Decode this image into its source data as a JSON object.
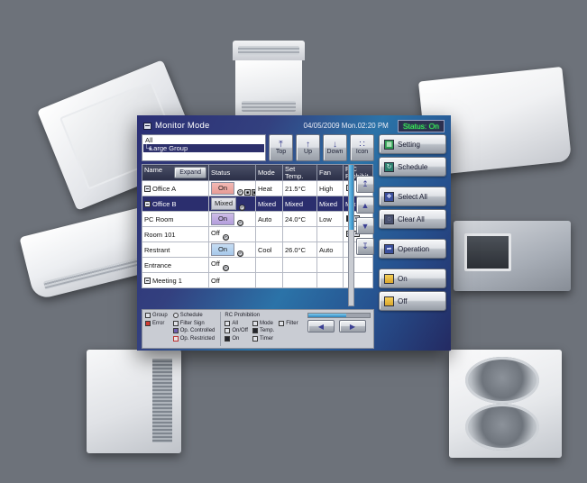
{
  "window": {
    "icon": "window-minimize-icon",
    "title": "Monitor Mode",
    "datetime": "04/05/2009 Mon.02:20 PM",
    "status_badge": "Status:  On",
    "status_color": "#39ff5a"
  },
  "tree": {
    "root_label": "All",
    "selected_label": "Large Group"
  },
  "nav_buttons": [
    {
      "label": "Top",
      "icon": "arrow-top-icon",
      "glyph": "⤒"
    },
    {
      "label": "Up",
      "icon": "arrow-up-icon",
      "glyph": "↑"
    },
    {
      "label": "Down",
      "icon": "arrow-down-icon",
      "glyph": "↓"
    },
    {
      "label": "Icon",
      "icon": "grid-view-icon",
      "glyph": "∷"
    }
  ],
  "table": {
    "expand_button": "Expand",
    "columns": [
      {
        "key": "name",
        "label": "Name"
      },
      {
        "key": "status",
        "label": "Status"
      },
      {
        "key": "mode",
        "label": "Mode"
      },
      {
        "key": "temp",
        "label": "Set\nTemp."
      },
      {
        "key": "fan",
        "label": "Fan"
      },
      {
        "key": "rc",
        "label": "R/C\nProhibit"
      }
    ],
    "column_labels": {
      "name": "Name",
      "status": "Status",
      "mode": "Mode",
      "temp_line1": "Set",
      "temp_line2": "Temp.",
      "fan": "Fan",
      "rc_line1": "R/C",
      "rc_line2": "Prohibit"
    },
    "rows": [
      {
        "name": "Office A",
        "group_icon": true,
        "selected": false,
        "status": "On",
        "status_style": "on-pink",
        "status_icons": [
          "schedule-icon",
          "op-controlled-icon",
          "filter-sign-icon",
          "op-restricted-icon"
        ],
        "mode": "Heat",
        "temp": "21.5°C",
        "fan": "High",
        "rc": "",
        "rc_icons": [
          "rc-all-icon"
        ]
      },
      {
        "name": "Office B",
        "group_icon": true,
        "selected": true,
        "status": "Mixed",
        "status_style": "mixed",
        "status_icons": [
          "schedule-icon"
        ],
        "mode": "Mixed",
        "temp": "Mixed",
        "fan": "Mixed",
        "rc": "Mixed",
        "rc_icons": []
      },
      {
        "name": "PC Room",
        "group_icon": false,
        "selected": false,
        "status": "On",
        "status_style": "on-purple",
        "status_icons": [
          "schedule-icon"
        ],
        "mode": "Auto",
        "temp": "24.0°C",
        "fan": "Low",
        "rc": "",
        "rc_icons": [
          "rc-on-icon",
          "rc-timer-icon"
        ]
      },
      {
        "name": "Room 101",
        "group_icon": false,
        "selected": false,
        "status": "Off",
        "status_style": "plain",
        "status_icons": [
          "schedule-icon"
        ],
        "mode": "",
        "temp": "",
        "fan": "",
        "rc": "",
        "rc_icons": [
          "rc-onoff-icon",
          "rc-timer-icon"
        ]
      },
      {
        "name": "Restrant",
        "group_icon": false,
        "selected": false,
        "status": "On",
        "status_style": "on-blue",
        "status_icons": [
          "schedule-icon"
        ],
        "mode": "Cool",
        "temp": "26.0°C",
        "fan": "Auto",
        "rc": "",
        "rc_icons": []
      },
      {
        "name": "Entrance",
        "group_icon": false,
        "selected": false,
        "status": "Off",
        "status_style": "plain",
        "status_icons": [
          "schedule-icon"
        ],
        "mode": "",
        "temp": "",
        "fan": "",
        "rc": "",
        "rc_icons": []
      },
      {
        "name": "Meeting 1",
        "group_icon": true,
        "selected": false,
        "status": "Off",
        "status_style": "plain",
        "status_icons": [],
        "mode": "",
        "temp": "",
        "fan": "",
        "rc": "",
        "rc_icons": []
      }
    ]
  },
  "scroll_arrows": [
    {
      "name": "scroll-top-button",
      "glyph": "↥"
    },
    {
      "name": "scroll-up-button",
      "glyph": "▲"
    },
    {
      "name": "scroll-down-button",
      "glyph": "▼"
    },
    {
      "name": "scroll-bottom-button",
      "glyph": "↧"
    }
  ],
  "legend": {
    "col1": [
      {
        "label": "Group",
        "icon": "group-icon",
        "style": "plain"
      },
      {
        "label": "Error",
        "icon": "error-icon",
        "style": "redfill"
      }
    ],
    "col2": [
      {
        "label": "Schedule",
        "icon": "schedule-icon",
        "style": "round"
      },
      {
        "label": "Filter Sign",
        "icon": "filter-sign-icon",
        "style": "plain"
      },
      {
        "label": "Op. Controlled",
        "icon": "op-controlled-icon",
        "style": "purple"
      },
      {
        "label": "Op. Restricted",
        "icon": "op-restricted-icon",
        "style": "red"
      }
    ],
    "rc_title": "RC Prohibition",
    "rc_items": [
      {
        "label": "All",
        "icon": "rc-all-icon",
        "style": "plain"
      },
      {
        "label": "Mode",
        "icon": "rc-mode-icon",
        "style": "plain"
      },
      {
        "label": "Filter",
        "icon": "rc-filter-icon",
        "style": "plain"
      },
      {
        "label": "On/Off",
        "icon": "rc-onoff-icon",
        "style": "plain"
      },
      {
        "label": "Temp.",
        "icon": "rc-temp-icon",
        "style": "black"
      },
      {
        "label": "",
        "icon": "",
        "style": "none"
      },
      {
        "label": "On",
        "icon": "rc-on-icon",
        "style": "black"
      },
      {
        "label": "Timer",
        "icon": "rc-timer-icon",
        "style": "plain"
      },
      {
        "label": "",
        "icon": "",
        "style": "none"
      }
    ]
  },
  "page_buttons": [
    {
      "name": "prev-page-button",
      "glyph": "◀"
    },
    {
      "name": "next-page-button",
      "glyph": "▶"
    }
  ],
  "rail": [
    {
      "label": "Setting",
      "icon": "calendar-icon",
      "style": "green",
      "glyph": "▦"
    },
    {
      "label": "Schedule",
      "icon": "schedule-icon",
      "style": "teal",
      "glyph": "↻"
    },
    {
      "label": "Select All",
      "icon": "select-all-icon",
      "style": "blue",
      "glyph": "❖"
    },
    {
      "label": "Clear All",
      "icon": "clear-all-icon",
      "style": "slate",
      "glyph": "◌"
    },
    {
      "label": "Operation",
      "icon": "operation-icon",
      "style": "blue",
      "glyph": "➦"
    },
    {
      "label": "On",
      "icon": "power-on-icon",
      "style": "gold",
      "glyph": ""
    },
    {
      "label": "Off",
      "icon": "power-off-icon",
      "style": "gold",
      "glyph": ""
    }
  ]
}
